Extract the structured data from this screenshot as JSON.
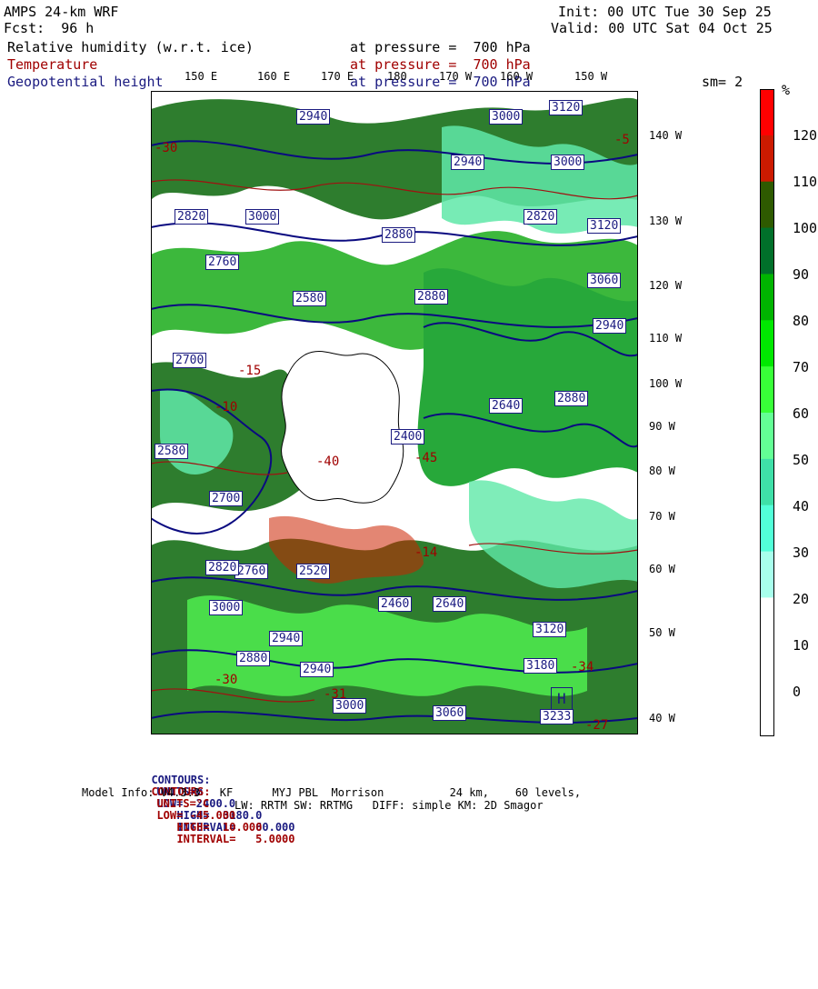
{
  "header": {
    "model": "AMPS 24-km WRF",
    "init": "Init: 00 UTC Tue 30 Sep 25",
    "fcst": "Fcst:  96 h",
    "valid": "Valid: 00 UTC Sat 04 Oct 25",
    "fields": [
      {
        "name": "Relative humidity (w.r.t. ice)",
        "level": "at pressure =  700 hPa",
        "color": "#000000"
      },
      {
        "name": "Temperature",
        "level": "at pressure =  700 hPa",
        "color": "#a00000"
      },
      {
        "name": "Geopotential height",
        "level": "at pressure =  700 hPa",
        "color": "#1a1a80"
      }
    ],
    "smoothing": "sm= 2"
  },
  "map": {
    "lon_labels": [
      "150 E",
      "160 E",
      "170 E",
      "180",
      "170 W",
      "160 W",
      "150 W"
    ],
    "lat_labels": [
      "140 W",
      "130 W",
      "120 W",
      "110 W",
      "100 W",
      "90 W",
      "80 W",
      "70 W",
      "60 W",
      "50 W",
      "40 W"
    ],
    "height_labels": [
      "2940",
      "3000",
      "3120",
      "2820",
      "2940",
      "3000",
      "3120",
      "3000",
      "2820",
      "2880",
      "2760",
      "2880",
      "2940",
      "3060",
      "2700",
      "2580",
      "2880",
      "3000",
      "2940",
      "2640",
      "2520",
      "2400",
      "2460",
      "2640",
      "2580",
      "2700",
      "2760",
      "2820",
      "2880",
      "2940",
      "3000",
      "3060",
      "3120",
      "3180",
      "3233"
    ],
    "temp_labels": [
      "-30",
      "-15",
      "-10",
      "-40",
      "-45",
      "-14",
      "-5",
      "-34",
      "-27",
      "-30",
      "-31"
    ],
    "highs": [
      "H"
    ],
    "colors": {
      "height_contour": "#0a0a80",
      "temp_contour": "#a01010",
      "land": "#ffffff",
      "wind_barb": "#333333"
    }
  },
  "colorbar": {
    "unit": "%",
    "ticks": [
      "120",
      "110",
      "100",
      "90",
      "80",
      "70",
      "60",
      "50",
      "40",
      "30",
      "20",
      "10",
      "0"
    ],
    "colors": [
      "#ff0000",
      "#cc1a00",
      "#2e5a00",
      "#00702a",
      "#00b400",
      "#00e800",
      "#38ff38",
      "#63ff95",
      "#3fe0a8",
      "#52ffd8",
      "#a8ffec",
      "#ffffff",
      "#ffffff",
      "#ffffff"
    ]
  },
  "footer": {
    "contours_height": {
      "label": "CONTOURS:",
      "units": "UNITS=m",
      "low": "LOW=  2400.0",
      "high": "HIGH=  3180.0",
      "interval": "INTERVAL=   60.000"
    },
    "contours_temp": {
      "label": "CONTOURS:",
      "units": "UNITS=°C",
      "low": "LOW= -45.000",
      "high": "HIGH=  10.000",
      "interval": "INTERVAL=   5.0000"
    },
    "model_info": "Model Info: V4.3.3   KF      MYJ PBL  Morrison          24 km,    60 levels,",
    "model_info2": "LW: RRTM SW: RRTMG   DIFF: simple KM: 2D Smagor"
  }
}
